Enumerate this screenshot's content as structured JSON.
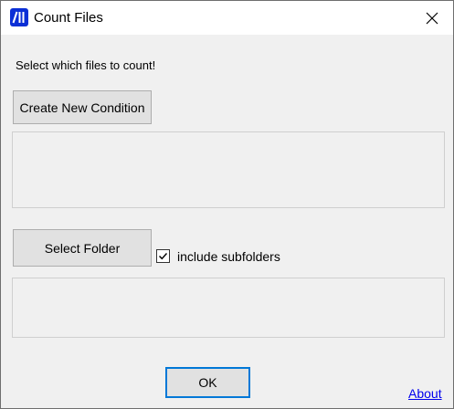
{
  "window": {
    "title": "Count Files",
    "icon": "app-logo-icon",
    "close_icon": "close-icon"
  },
  "main": {
    "instruction": "Select which files to count!",
    "create_condition_label": "Create New Condition",
    "select_folder_label": "Select Folder",
    "include_subfolders": {
      "label": "include subfolders",
      "checked": true
    },
    "ok_label": "OK",
    "about_label": "About"
  },
  "colors": {
    "window_background": "#f0f0f0",
    "titlebar_background": "#ffffff",
    "app_icon_blue": "#0b2fd6",
    "focus_border": "#0078d7",
    "link": "#0000ee"
  }
}
